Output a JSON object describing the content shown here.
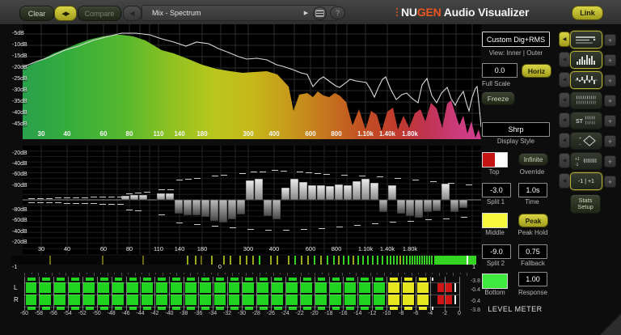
{
  "toolbar": {
    "clear_label": "Clear",
    "swap_icon": "◀▶",
    "compare_label": "Compare",
    "prev_icon": "◀",
    "preset_name": "Mix - Spectrum",
    "next_icon": "▶",
    "help_label": "?",
    "brand_nu": "NU",
    "brand_gen": "GEN",
    "brand_rest": " Audio Visualizer",
    "link_label": "Link"
  },
  "spectrum": {
    "db_labels": [
      "-5dB",
      "-10dB",
      "-15dB",
      "-20dB",
      "-25dB",
      "-30dB",
      "-35dB",
      "-40dB",
      "-45dB"
    ],
    "freq_labels": [
      [
        "30",
        23
      ],
      [
        "40",
        55
      ],
      [
        "60",
        100
      ],
      [
        "80",
        132
      ],
      [
        "110",
        168
      ],
      [
        "140",
        194
      ],
      [
        "180",
        222
      ],
      [
        "300",
        279
      ],
      [
        "400",
        311
      ],
      [
        "600",
        356
      ],
      [
        "800",
        388
      ],
      [
        "1.10k",
        424
      ],
      [
        "1.40k",
        451
      ],
      [
        "1.80k",
        479
      ]
    ],
    "grid_x": [
      23,
      55,
      80,
      100,
      117,
      132,
      145,
      157,
      168,
      194,
      222,
      245,
      263,
      279,
      311,
      336,
      356,
      373,
      388,
      401,
      424,
      451,
      479,
      501,
      520,
      536,
      556
    ],
    "gradient": [
      [
        0,
        "#2aa04c"
      ],
      [
        0.1,
        "#35ad3c"
      ],
      [
        0.22,
        "#55b82e"
      ],
      [
        0.32,
        "#8cc122"
      ],
      [
        0.42,
        "#bac61c"
      ],
      [
        0.5,
        "#c6b81a"
      ],
      [
        0.58,
        "#c79a1c"
      ],
      [
        0.66,
        "#c5761e"
      ],
      [
        0.74,
        "#c25022"
      ],
      [
        0.82,
        "#bf3a2e"
      ],
      [
        0.88,
        "#c03350"
      ],
      [
        0.94,
        "#ca3a78"
      ],
      [
        1,
        "#d04090"
      ]
    ],
    "fill_points": [
      [
        0,
        55
      ],
      [
        12,
        49
      ],
      [
        23,
        44
      ],
      [
        38,
        36
      ],
      [
        54,
        30
      ],
      [
        68,
        24
      ],
      [
        82,
        19
      ],
      [
        99,
        15
      ],
      [
        112,
        13
      ],
      [
        122,
        13
      ],
      [
        137,
        15
      ],
      [
        152,
        20
      ],
      [
        172,
        32
      ],
      [
        187,
        36
      ],
      [
        205,
        43
      ],
      [
        222,
        50
      ],
      [
        239,
        55
      ],
      [
        257,
        58
      ],
      [
        272,
        60
      ],
      [
        287,
        59
      ],
      [
        302,
        58
      ],
      [
        315,
        62
      ],
      [
        329,
        77
      ],
      [
        335,
        107
      ],
      [
        342,
        87
      ],
      [
        352,
        85
      ],
      [
        359,
        90
      ],
      [
        365,
        83
      ],
      [
        372,
        88
      ],
      [
        379,
        90
      ],
      [
        386,
        85
      ],
      [
        392,
        88
      ],
      [
        400,
        96
      ],
      [
        408,
        125
      ],
      [
        416,
        105
      ],
      [
        424,
        130
      ],
      [
        431,
        107
      ],
      [
        438,
        112
      ],
      [
        444,
        132
      ],
      [
        451,
        108
      ],
      [
        458,
        103
      ],
      [
        464,
        130
      ],
      [
        471,
        113
      ],
      [
        478,
        128
      ],
      [
        485,
        110
      ],
      [
        492,
        105
      ],
      [
        498,
        120
      ],
      [
        505,
        97
      ],
      [
        512,
        104
      ],
      [
        519,
        128
      ],
      [
        525,
        98
      ],
      [
        530,
        94
      ],
      [
        535,
        110
      ],
      [
        540,
        125
      ],
      [
        545,
        113
      ],
      [
        550,
        135
      ],
      [
        555,
        120
      ],
      [
        560,
        140
      ],
      [
        564,
        130
      ],
      [
        567,
        142
      ]
    ],
    "line_points": [
      [
        0,
        53
      ],
      [
        17,
        46
      ],
      [
        32,
        41
      ],
      [
        52,
        32
      ],
      [
        69,
        27
      ],
      [
        87,
        20
      ],
      [
        102,
        16
      ],
      [
        122,
        11
      ],
      [
        140,
        11
      ],
      [
        157,
        13
      ],
      [
        172,
        18
      ],
      [
        187,
        22
      ],
      [
        202,
        27
      ],
      [
        215,
        22
      ],
      [
        230,
        24
      ],
      [
        242,
        30
      ],
      [
        255,
        35
      ],
      [
        267,
        40
      ],
      [
        277,
        43
      ],
      [
        290,
        42
      ],
      [
        302,
        44
      ],
      [
        314,
        50
      ],
      [
        322,
        52
      ],
      [
        334,
        56
      ],
      [
        344,
        60
      ],
      [
        352,
        62
      ],
      [
        359,
        77
      ],
      [
        367,
        68
      ],
      [
        372,
        65
      ],
      [
        380,
        71
      ],
      [
        387,
        76
      ],
      [
        392,
        78
      ],
      [
        400,
        72
      ],
      [
        405,
        68
      ],
      [
        412,
        70
      ],
      [
        419,
        71
      ],
      [
        425,
        72
      ],
      [
        430,
        80
      ],
      [
        435,
        90
      ],
      [
        440,
        78
      ],
      [
        445,
        68
      ],
      [
        449,
        65
      ],
      [
        455,
        80
      ],
      [
        462,
        93
      ],
      [
        469,
        87
      ],
      [
        475,
        85
      ],
      [
        482,
        92
      ],
      [
        489,
        97
      ],
      [
        494,
        75
      ],
      [
        500,
        67
      ],
      [
        506,
        88
      ],
      [
        512,
        97
      ],
      [
        518,
        85
      ],
      [
        525,
        78
      ],
      [
        530,
        92
      ],
      [
        535,
        100
      ],
      [
        540,
        90
      ],
      [
        545,
        83
      ],
      [
        549,
        98
      ],
      [
        552,
        107
      ],
      [
        556,
        90
      ],
      [
        560,
        79
      ],
      [
        562,
        77
      ],
      [
        565,
        105
      ],
      [
        567,
        127
      ]
    ]
  },
  "split": {
    "db_labels_top": [
      "-20dB",
      "-40dB",
      "-60dB",
      "-80dB"
    ],
    "db_labels_bottom": [
      "-80dB",
      "-60dB",
      "-40dB",
      "-20dB"
    ],
    "bars": [
      5,
      6,
      6,
      0,
      8,
      8,
      -17,
      -19,
      -19,
      -21,
      -26,
      -28,
      -24,
      -18,
      24,
      26,
      -20,
      -24,
      15,
      26,
      22,
      18,
      18,
      17,
      19,
      18,
      23,
      26,
      21,
      -15,
      18,
      -17,
      -20,
      -22,
      -15,
      -14,
      20,
      -15,
      -10,
      0
    ],
    "dashes": [
      [
        7,
        -2
      ],
      [
        18,
        -2
      ],
      [
        29,
        -2
      ],
      [
        40,
        -3
      ],
      [
        51,
        -3
      ],
      [
        62,
        -3
      ],
      [
        73,
        -3
      ],
      [
        84,
        -4
      ],
      [
        95,
        -4
      ],
      [
        106,
        -4
      ],
      [
        117,
        -4
      ],
      [
        7,
        3
      ],
      [
        18,
        3
      ],
      [
        29,
        3
      ],
      [
        40,
        3
      ],
      [
        51,
        4
      ],
      [
        62,
        4
      ],
      [
        73,
        4
      ],
      [
        84,
        4
      ],
      [
        95,
        5
      ],
      [
        106,
        5
      ],
      [
        117,
        5
      ],
      [
        128,
        -8
      ],
      [
        139,
        -9
      ],
      [
        150,
        -10
      ],
      [
        168,
        -13
      ],
      [
        179,
        -13
      ],
      [
        190,
        -25
      ],
      [
        201,
        -26
      ],
      [
        212,
        -27
      ],
      [
        234,
        -30
      ],
      [
        245,
        -31
      ],
      [
        268,
        -33
      ],
      [
        282,
        -35
      ],
      [
        293,
        -35
      ],
      [
        308,
        -37
      ],
      [
        319,
        -36
      ],
      [
        339,
        -35
      ],
      [
        350,
        -34
      ],
      [
        361,
        -33
      ],
      [
        372,
        -32
      ],
      [
        394,
        -31
      ],
      [
        416,
        -30
      ],
      [
        438,
        -29
      ],
      [
        460,
        -27
      ],
      [
        482,
        -25
      ],
      [
        504,
        -23
      ],
      [
        526,
        -21
      ],
      [
        548,
        -19
      ],
      [
        128,
        12
      ],
      [
        139,
        13
      ],
      [
        168,
        18
      ],
      [
        190,
        28
      ],
      [
        212,
        30
      ],
      [
        234,
        32
      ],
      [
        256,
        34
      ],
      [
        278,
        36
      ],
      [
        300,
        37
      ],
      [
        322,
        37
      ],
      [
        344,
        36
      ],
      [
        366,
        35
      ],
      [
        388,
        33
      ],
      [
        410,
        31
      ],
      [
        432,
        29
      ],
      [
        454,
        27
      ],
      [
        476,
        26
      ],
      [
        498,
        24
      ],
      [
        520,
        23
      ],
      [
        542,
        21
      ]
    ]
  },
  "correlation": {
    "label_left": "-1",
    "label_mid": "0",
    "label_right": "1",
    "line_colors": [
      "#6a6a14",
      "#9aa81c",
      "#35d422"
    ],
    "lines": [
      [
        47,
        0
      ],
      [
        112,
        0
      ],
      [
        162,
        0
      ],
      [
        217,
        1
      ],
      [
        227,
        1
      ],
      [
        234,
        0
      ],
      [
        247,
        1
      ],
      [
        262,
        1
      ],
      [
        270,
        1
      ],
      [
        282,
        1
      ],
      [
        290,
        1
      ],
      [
        298,
        1
      ],
      [
        306,
        2
      ],
      [
        320,
        1
      ],
      [
        328,
        1
      ],
      [
        342,
        1
      ],
      [
        350,
        2
      ],
      [
        358,
        1
      ],
      [
        366,
        1
      ],
      [
        374,
        2
      ],
      [
        382,
        1
      ],
      [
        390,
        2
      ],
      [
        398,
        2
      ],
      [
        404,
        1
      ],
      [
        410,
        2
      ],
      [
        416,
        2
      ],
      [
        422,
        1
      ],
      [
        428,
        2
      ],
      [
        434,
        2
      ],
      [
        440,
        2
      ],
      [
        446,
        2
      ],
      [
        452,
        2
      ],
      [
        458,
        2
      ],
      [
        464,
        2
      ],
      [
        468,
        2
      ],
      [
        472,
        2
      ],
      [
        476,
        2
      ],
      [
        480,
        1
      ],
      [
        484,
        2
      ],
      [
        488,
        2
      ],
      [
        492,
        2
      ],
      [
        495,
        2
      ],
      [
        498,
        2
      ],
      [
        501,
        2
      ],
      [
        504,
        2
      ],
      [
        507,
        2
      ],
      [
        510,
        2
      ],
      [
        513,
        2
      ],
      [
        516,
        2
      ],
      [
        519,
        2
      ]
    ],
    "solid": [
      523,
      575
    ],
    "white_line": 563
  },
  "meter": {
    "channel_left": "L",
    "channel_right": "R",
    "scale": [
      "-60",
      "-58",
      "-56",
      "-54",
      "-52",
      "-50",
      "-48",
      "-46",
      "-44",
      "-42",
      "-40",
      "-38",
      "-36",
      "-34",
      "-32",
      "-30",
      "-28",
      "-26",
      "-24",
      "-22",
      "-20",
      "-18",
      "-16",
      "-14",
      "-12",
      "-10",
      "-8",
      "-6",
      "-4",
      "-2",
      "0"
    ],
    "values": [
      "-3.8",
      "-0.4",
      "-0.4",
      "-3.8"
    ],
    "title": "LEVEL METER",
    "green": "#1fd41f",
    "yellow": "#e6e61e",
    "red": "#cf1616"
  },
  "sidebar": {
    "mode": "Custom Dig+RMS",
    "view_label": "View: Inner | Outer",
    "full_scale_value": "0.0",
    "horiz_label": "Horiz",
    "full_scale_label": "Full Scale",
    "freeze_label": "Freeze",
    "display_style_value": "Shrp",
    "display_style_label": "Display Style",
    "top_label": "Top",
    "override_btn": "Infinite",
    "override_label": "Override",
    "split1_value": "-3.0",
    "split1_label": "Split 1",
    "time_value": "1.0s",
    "time_label": "Time",
    "middle_label": "Middle",
    "peak_btn": "Peak",
    "peak_label": "Peak Hold",
    "split2_value": "-9.0",
    "split2_label": "Split 2",
    "fallback_value": "0.75",
    "fallback_label": "Fallback",
    "bottom_label": "Bottom",
    "response_value": "1.00",
    "response_label": "Response",
    "swatch_top_left": "#c41414",
    "swatch_top_right": "#ffffff",
    "swatch_middle": "#f6f63c",
    "swatch_bottom": "#3fe93f"
  },
  "iconstrip": {
    "plus": "+",
    "arrow": "◀",
    "st_text": "ST",
    "plus_one": "+1",
    "minus_one": "-1",
    "vector_plus": "+",
    "vector_minus": "−",
    "corr_text": "-1 | +1",
    "stats_line1": "Stats",
    "stats_line2": "Setup"
  }
}
